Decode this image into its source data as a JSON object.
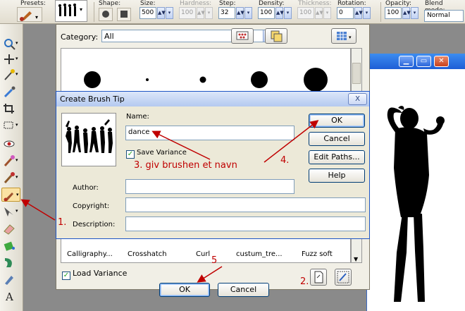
{
  "options_bar": {
    "presets_label": "Presets:",
    "shape_label": "Shape:",
    "size_label": "Size:",
    "size_value": "500",
    "hardness_label": "Hardness:",
    "hardness_value": "100",
    "step_label": "Step:",
    "step_value": "32",
    "density_label": "Density:",
    "density_value": "100",
    "thickness_label": "Thickness:",
    "thickness_value": "100",
    "rotation_label": "Rotation:",
    "rotation_value": "0",
    "opacity_label": "Opacity:",
    "opacity_value": "100",
    "blend_label": "Blend mode:",
    "blend_value": "Normal"
  },
  "brush_picker": {
    "category_label": "Category:",
    "category_value": "All",
    "brush_names": [
      "Calligraphy...",
      "Crosshatch",
      "Curl",
      "custum_tre...",
      "Fuzz soft"
    ],
    "load_variance_label": "Load Variance",
    "load_variance_checked": true,
    "ok_label": "OK",
    "cancel_label": "Cancel"
  },
  "dialog": {
    "title": "Create Brush Tip",
    "close_label": "X",
    "name_label": "Name:",
    "name_value": "dance",
    "save_variance_label": "Save Variance",
    "save_variance_checked": true,
    "author_label": "Author:",
    "author_value": "",
    "copyright_label": "Copyright:",
    "copyright_value": "",
    "description_label": "Description:",
    "description_value": "",
    "ok_label": "OK",
    "cancel_label": "Cancel",
    "edit_paths_label": "Edit Paths...",
    "help_label": "Help"
  },
  "annotations": {
    "step1": "1.",
    "step2": "2.",
    "step3": "3. giv brushen et navn",
    "step4": "4.",
    "step5": "5"
  },
  "colors": {
    "annotation": "#c00000",
    "dialog_bg": "#ece9d8",
    "title_blue": "#1e5ed6"
  }
}
